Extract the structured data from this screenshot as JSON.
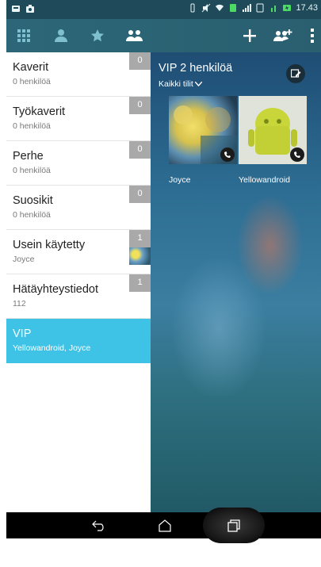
{
  "status_bar": {
    "time": "17.43",
    "icons": [
      "notification-icon",
      "screenshot-icon",
      "vibrate-icon",
      "mute-icon",
      "wifi-icon",
      "signal-icon",
      "battery-icon"
    ]
  },
  "toolbar": {
    "tabs": [
      "apps-grid-icon",
      "contacts-icon",
      "favorites-star-icon",
      "groups-icon"
    ],
    "actions": [
      "add-icon",
      "add-group-icon",
      "overflow-menu-icon"
    ],
    "accent": "#2c6678"
  },
  "groups": [
    {
      "name": "Kaverit",
      "sub": "0 henkilöä",
      "count": "0"
    },
    {
      "name": "Työkaverit",
      "sub": "0 henkilöä",
      "count": "0"
    },
    {
      "name": "Perhe",
      "sub": "0 henkilöä",
      "count": "0"
    },
    {
      "name": "Suosikit",
      "sub": "0 henkilöä",
      "count": "0"
    },
    {
      "name": "Usein käytetty",
      "sub": "Joyce",
      "count": "1"
    },
    {
      "name": "Hätäyhteystiedot",
      "sub": "112",
      "count": "1"
    },
    {
      "name": "VIP",
      "sub": "Yellowandroid, Joyce",
      "count": ""
    }
  ],
  "selection_color": "#3ec3e6",
  "detail": {
    "title": "VIP 2 henkilöä",
    "account_filter": "Kaikki tilit",
    "members": [
      {
        "name": "Joyce"
      },
      {
        "name": "Yellowandroid"
      }
    ]
  }
}
